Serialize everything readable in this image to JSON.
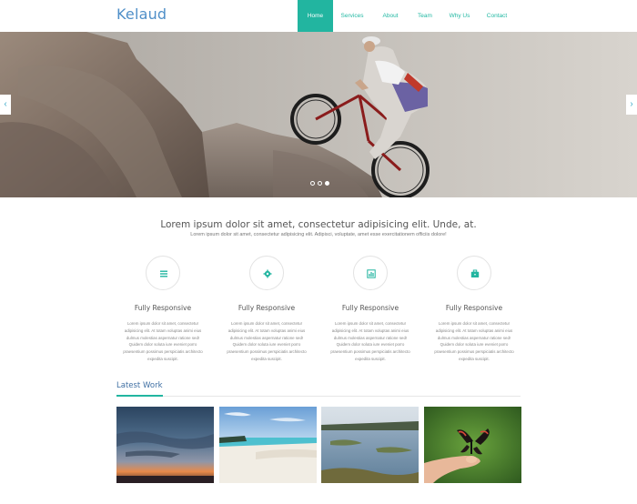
{
  "header": {
    "logo": "Kelaud",
    "nav": [
      {
        "label": "Home",
        "active": true
      },
      {
        "label": "Services",
        "active": false
      },
      {
        "label": "About",
        "active": false
      },
      {
        "label": "Team",
        "active": false
      },
      {
        "label": "Why Us",
        "active": false
      },
      {
        "label": "Contact",
        "active": false
      }
    ]
  },
  "hero": {
    "slide_count": 3,
    "active_slide": 3,
    "prev_icon": "chevron-left-icon",
    "next_icon": "chevron-right-icon"
  },
  "intro": {
    "title": "Lorem ipsum dolor sit amet, consectetur adipisicing elit. Unde, at.",
    "subtitle": "Lorem ipsum dolor sit amet, consectetur adipisicing elit. Adipisci, voluptate, amet esse exercitationem officiis dolore!"
  },
  "features": [
    {
      "icon": "list-icon",
      "title": "Fully Responsive",
      "text": "Lorem ipsum dolor sit amet, consectetur adipisicing elit. At totam voluptas animi eius dulmus molestias aspernatur ratione sed! Quidem dolor soluta iure eveniet porro praesentium possimus perspiciatis architecto expedita suscipit."
    },
    {
      "icon": "gear-icon",
      "title": "Fully Responsive",
      "text": "Lorem ipsum dolor sit amet, consectetur adipisicing elit. At totam voluptas animi eius dulmus molestias aspernatur ratione sed! Quidem dolor soluta iure eveniet porro praesentium possimus perspiciatis architecto expedita suscipit."
    },
    {
      "icon": "bar-chart-icon",
      "title": "Fully Responsive",
      "text": "Lorem ipsum dolor sit amet, consectetur adipisicing elit. At totam voluptas animi eius dulmus molestias aspernatur ratione sed! Quidem dolor soluta iure eveniet porro praesentium possimus perspiciatis architecto expedita suscipit."
    },
    {
      "icon": "briefcase-icon",
      "title": "Fully Responsive",
      "text": "Lorem ipsum dolor sit amet, consectetur adipisicing elit. At totam voluptas animi eius dulmus molestias aspernatur ratione sed! Quidem dolor soluta iure eveniet porro praesentium possimus perspiciatis architecto expedita suscipit."
    }
  ],
  "latest": {
    "title": "Latest Work",
    "thumbs": [
      "sunset-sky",
      "tropical-beach",
      "river-landscape",
      "butterfly-on-finger"
    ]
  },
  "colors": {
    "accent": "#22b5a0",
    "logo": "#4f8fc8",
    "latest_title": "#3f6fa3"
  }
}
